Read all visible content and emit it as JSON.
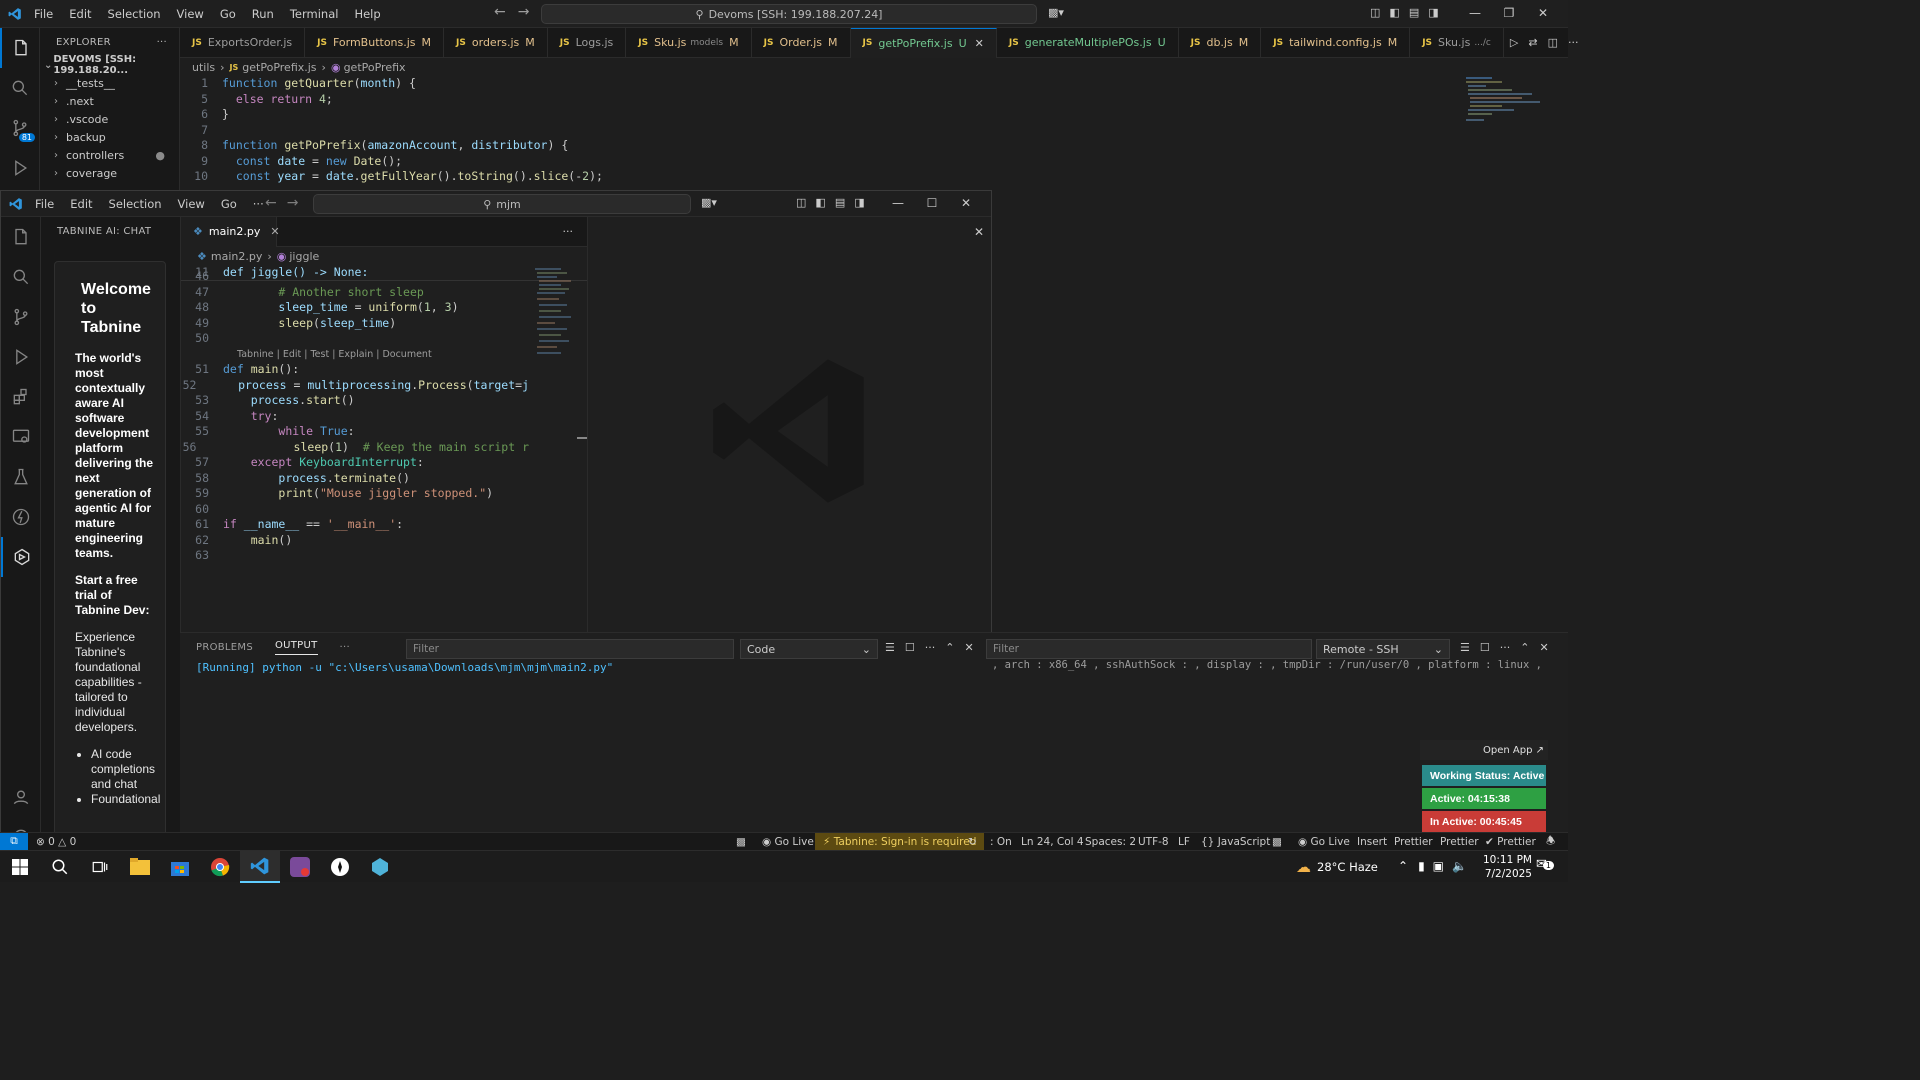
{
  "bg_window": {
    "menu": [
      "File",
      "Edit",
      "Selection",
      "View",
      "Go",
      "Run",
      "Terminal",
      "Help"
    ],
    "search": "Devoms [SSH: 199.188.207.24]",
    "explorer_title": "EXPLORER",
    "root_folder": "DEVOMS [SSH: 199.188.20...",
    "tree": [
      "__tests__",
      ".next",
      ".vscode",
      "backup",
      "controllers",
      "coverage"
    ],
    "source_control_badge": "81",
    "tabs": [
      {
        "name": "ExportsOrder.js",
        "flag": ""
      },
      {
        "name": "FormButtons.js",
        "flag": "M"
      },
      {
        "name": "orders.js",
        "flag": "M"
      },
      {
        "name": "Logs.js",
        "flag": ""
      },
      {
        "name": "Sku.js",
        "hint": "models",
        "flag": "M"
      },
      {
        "name": "Order.js",
        "flag": "M"
      },
      {
        "name": "getPoPrefix.js",
        "flag": "U"
      },
      {
        "name": "generateMultiplePOs.js",
        "flag": "U"
      },
      {
        "name": "db.js",
        "flag": "M"
      },
      {
        "name": "tailwind.config.js",
        "flag": "M"
      },
      {
        "name": "Sku.js",
        "hint": ".../c",
        "flag": ""
      }
    ],
    "breadcrumb": [
      "utils",
      "getPoPrefix.js",
      "getPoPrefix"
    ],
    "code": [
      {
        "n": "1",
        "t": "function getQuarter(month) {"
      },
      {
        "n": "5",
        "t": "  else return 4;"
      },
      {
        "n": "6",
        "t": "}"
      },
      {
        "n": "7",
        "t": ""
      },
      {
        "n": "8",
        "t": "function getPoPrefix(amazonAccount, distributor) {"
      },
      {
        "n": "9",
        "t": "  const date = new Date();"
      },
      {
        "n": "10",
        "t": "  const year = date.getFullYear().toString().slice(-2);"
      }
    ]
  },
  "fg_window": {
    "menu": [
      "File",
      "Edit",
      "Selection",
      "View",
      "Go"
    ],
    "more": "···",
    "search": "mjm",
    "side_title": "TABNINE AI: CHAT",
    "tabnine": {
      "title": "Welcome to Tabnine",
      "tagline": "The world's most contextually aware AI software development platform delivering the next generation of agentic AI for mature engineering teams.",
      "cta": "Start a free trial of Tabnine Dev:",
      "desc": "Experience Tabnine's foundational capabilities - tailored to individual developers.",
      "bullets": [
        "AI code completions and chat",
        "Foundational"
      ]
    },
    "tab": "main2.py",
    "breadcrumb": [
      "main2.py",
      "jiggle"
    ],
    "sticky": {
      "n": "11",
      "t": "def jiggle() -> None:"
    },
    "codelens": "Tabnine | Edit | Test | Explain | Document",
    "code": [
      {
        "n": "46",
        "t": ""
      },
      {
        "n": "47",
        "t": "        # Another short sleep"
      },
      {
        "n": "48",
        "t": "        sleep_time = uniform(1, 3)"
      },
      {
        "n": "49",
        "t": "        sleep(sleep_time)"
      },
      {
        "n": "50",
        "t": ""
      },
      {
        "n": "51",
        "t": "def main():"
      },
      {
        "n": "52",
        "t": "    process = multiprocessing.Process(target=j"
      },
      {
        "n": "53",
        "t": "    process.start()"
      },
      {
        "n": "54",
        "t": "    try:"
      },
      {
        "n": "55",
        "t": "        while True:"
      },
      {
        "n": "56",
        "t": "            sleep(1)  # Keep the main script r"
      },
      {
        "n": "57",
        "t": "    except KeyboardInterrupt:"
      },
      {
        "n": "58",
        "t": "        process.terminate()"
      },
      {
        "n": "59",
        "t": "        print(\"Mouse jiggler stopped.\")"
      },
      {
        "n": "60",
        "t": ""
      },
      {
        "n": "61",
        "t": "if __name__ == '__main__':"
      },
      {
        "n": "62",
        "t": "    main()"
      },
      {
        "n": "63",
        "t": ""
      }
    ]
  },
  "panel": {
    "tabs": [
      "PROBLEMS",
      "OUTPUT"
    ],
    "more": "···",
    "filter_placeholder": "Filter",
    "channel": "Code",
    "output": "[Running] python -u \"c:\\Users\\usama\\Downloads\\mjm\\mjm\\main2.py\"",
    "right_filter": "Filter",
    "right_channel": "Remote - SSH",
    "right_output": ", arch : x86_64 , sshAuthSock :  , display :  , tmpDir : /run/user/0 , platform : linux ,",
    "open_app": "Open App ↗",
    "working_status": "Working Status: Active",
    "active": "Active: 04:15:38",
    "inactive": "In Active: 00:45:45"
  },
  "status": {
    "errors": "0",
    "warnings": "0",
    "go_live": "Go Live",
    "tabnine": "Tabnine: Sign-in is required",
    "on": ": On",
    "position": "Ln 24, Col 4",
    "spaces": "Spaces: 2",
    "encoding": "UTF-8",
    "eol": "LF",
    "language": "{} JavaScript",
    "go_live2": "Go Live",
    "insert": "Insert",
    "prettier": "Prettier",
    "prettier2": "Prettier",
    "prettier3": "✔ Prettier"
  },
  "taskbar": {
    "weather": "28°C  Haze",
    "time": "10:11 PM",
    "date": "7/2/2025",
    "notif": "1"
  },
  "colors": {
    "accent": "#0078d4",
    "modified": "#e2c08d",
    "untracked": "#73c991",
    "status_active": "#2ea043",
    "status_inactive": "#c93c37",
    "working": "#2a8a8a"
  }
}
